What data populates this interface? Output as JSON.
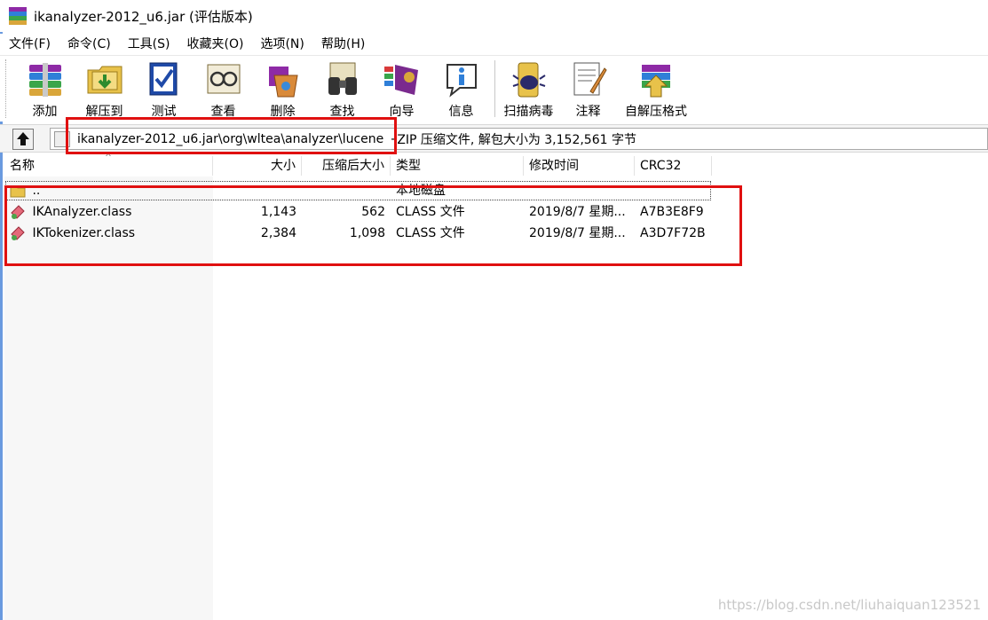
{
  "window": {
    "title": "ikanalyzer-2012_u6.jar (评估版本)"
  },
  "menu": [
    {
      "label": "文件(F)"
    },
    {
      "label": "命令(C)"
    },
    {
      "label": "工具(S)"
    },
    {
      "label": "收藏夹(O)"
    },
    {
      "label": "选项(N)"
    },
    {
      "label": "帮助(H)"
    }
  ],
  "toolbar": {
    "group1": [
      {
        "label": "添加",
        "icon": "archive-books-icon"
      },
      {
        "label": "解压到",
        "icon": "extract-folder-icon"
      },
      {
        "label": "测试",
        "icon": "test-book-icon"
      },
      {
        "label": "查看",
        "icon": "view-glasses-icon"
      },
      {
        "label": "删除",
        "icon": "delete-icon"
      },
      {
        "label": "查找",
        "icon": "find-binoculars-icon"
      },
      {
        "label": "向导",
        "icon": "wizard-icon"
      },
      {
        "label": "信息",
        "icon": "info-icon"
      }
    ],
    "group2": [
      {
        "label": "扫描病毒",
        "icon": "virus-scan-icon"
      },
      {
        "label": "注释",
        "icon": "comment-icon"
      },
      {
        "label": "自解压格式",
        "icon": "sfx-archive-icon"
      }
    ]
  },
  "address": {
    "path": "ikanalyzer-2012_u6.jar\\org\\wltea\\analyzer\\lucene",
    "info": "ZIP 压缩文件, 解包大小为 3,152,561 字节"
  },
  "columns": {
    "name": "名称",
    "size": "大小",
    "packed": "压缩后大小",
    "type": "类型",
    "modified": "修改时间",
    "crc": "CRC32"
  },
  "rows": [
    {
      "name": "..",
      "size": "",
      "packed": "",
      "type": "本地磁盘",
      "modified": "",
      "crc": "",
      "icon": "folder-icon"
    },
    {
      "name": "IKAnalyzer.class",
      "size": "1,143",
      "packed": "562",
      "type": "CLASS 文件",
      "modified": "2019/8/7 星期...",
      "crc": "A7B3E8F9",
      "icon": "class-file-icon"
    },
    {
      "name": "IKTokenizer.class",
      "size": "2,384",
      "packed": "1,098",
      "type": "CLASS 文件",
      "modified": "2019/8/7 星期...",
      "crc": "A3D7F72B",
      "icon": "class-file-icon"
    }
  ],
  "watermark": "https://blog.csdn.net/liuhaiquan123521",
  "colors": {
    "highlight_box": "#e01010",
    "title_accent": "#2b6fd1"
  }
}
